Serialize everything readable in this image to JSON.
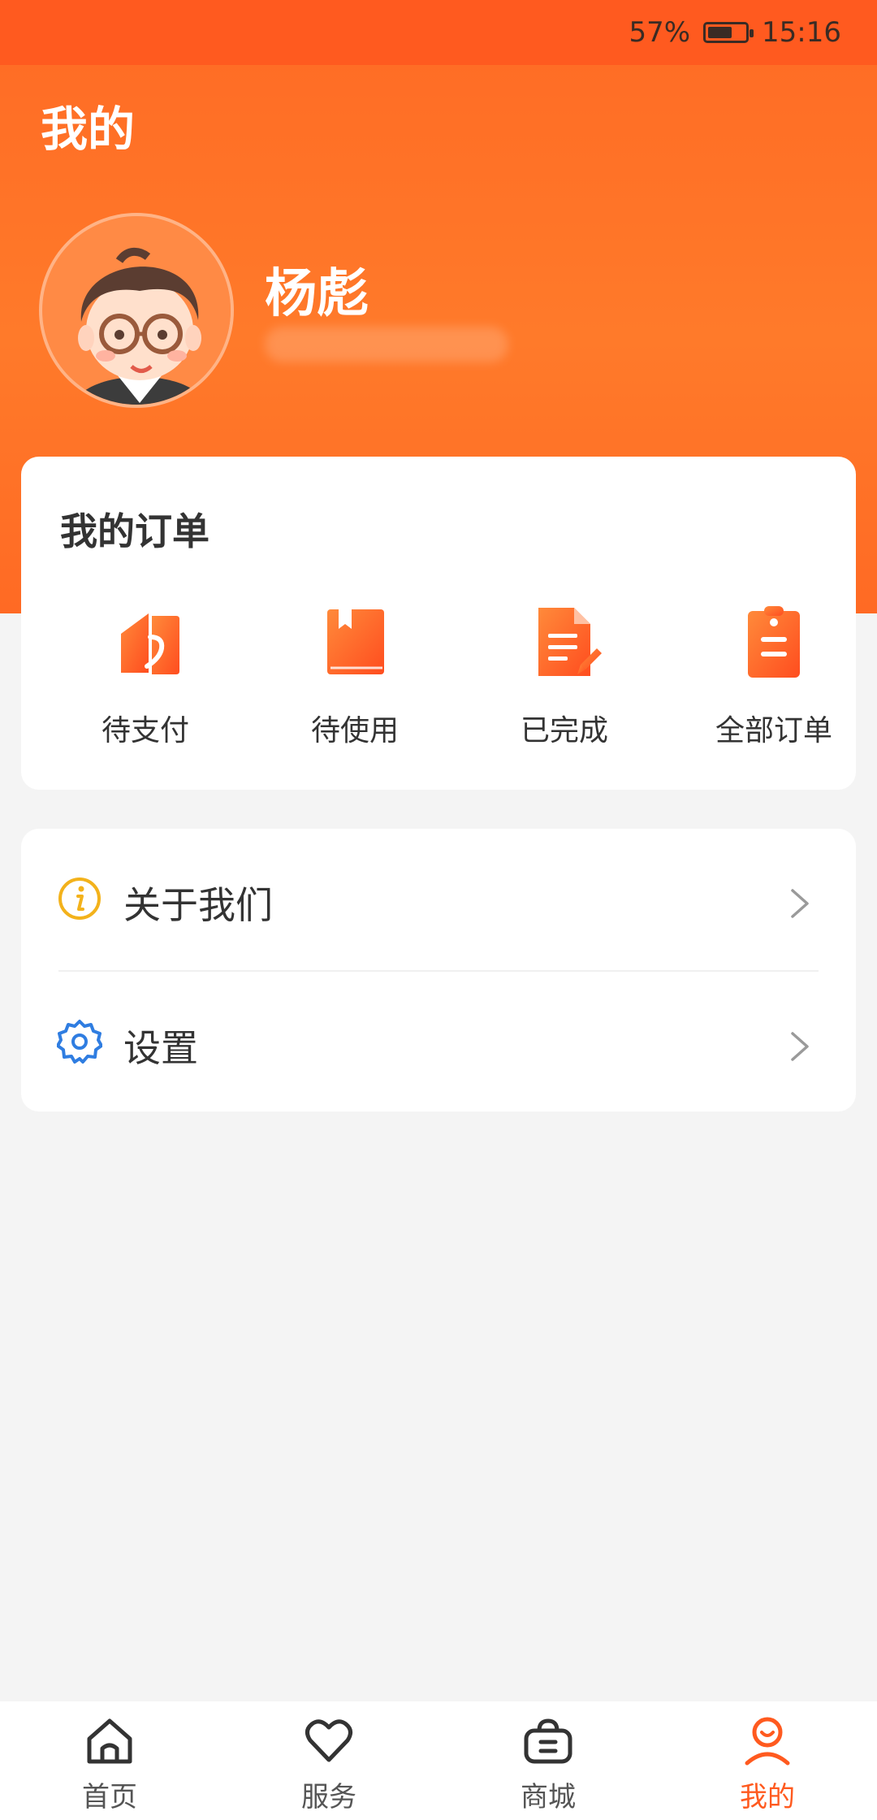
{
  "status_bar": {
    "battery_percent": "57%",
    "battery_level": 0.57,
    "time": "15:16"
  },
  "header": {
    "title": "我的"
  },
  "profile": {
    "username": "杨彪",
    "avatar_icon": "avatar-icon"
  },
  "orders": {
    "title": "我的订单",
    "items": [
      {
        "label": "待支付",
        "icon": "pay-icon"
      },
      {
        "label": "待使用",
        "icon": "book-icon"
      },
      {
        "label": "已完成",
        "icon": "document-edit-icon"
      },
      {
        "label": "全部订单",
        "icon": "clipboard-icon"
      }
    ]
  },
  "menu": {
    "items": [
      {
        "label": "关于我们",
        "icon": "info-icon"
      },
      {
        "label": "设置",
        "icon": "gear-icon"
      }
    ]
  },
  "bottom_nav": {
    "items": [
      {
        "label": "首页",
        "icon": "home-icon",
        "active": false
      },
      {
        "label": "服务",
        "icon": "heart-icon",
        "active": false
      },
      {
        "label": "商城",
        "icon": "shopping-bag-icon",
        "active": false
      },
      {
        "label": "我的",
        "icon": "user-icon",
        "active": true
      }
    ]
  },
  "colors": {
    "accent": "#ff5a1f",
    "hero_gradient_light": "#ff7a2a",
    "text_primary": "#333333",
    "background": "#f4f4f4",
    "info_icon": "#f3b21b",
    "settings_icon": "#2f7de1"
  }
}
